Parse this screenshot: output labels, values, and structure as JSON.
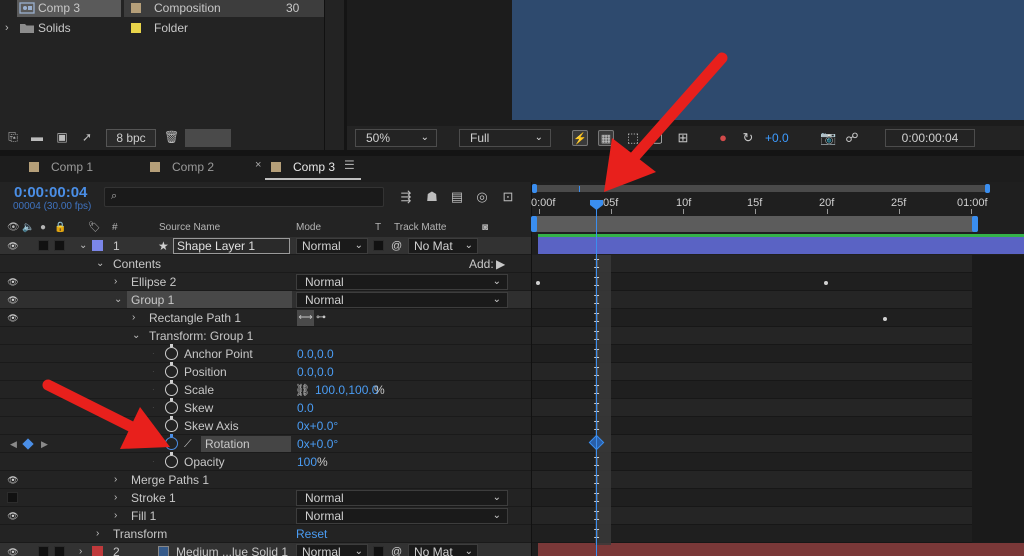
{
  "project": {
    "items": [
      {
        "name": "Comp 3",
        "type": "Composition",
        "frame_rate": "30",
        "color": "#b59f79",
        "twirl": "",
        "icon": "composition-icon"
      },
      {
        "name": "Solids",
        "type": "Folder",
        "frame_rate": "",
        "color": "#e8d44a",
        "twirl": "›",
        "icon": "folder-icon"
      }
    ],
    "footer": {
      "bit_depth": "8 bpc"
    }
  },
  "viewer": {
    "zoom": "50%",
    "resolution": "Full",
    "exposure": "+0.0",
    "timecode": "0:00:00:04"
  },
  "timeline": {
    "tabs": [
      {
        "label": "Comp 1",
        "color": "#b59f79"
      },
      {
        "label": "Comp 2",
        "color": "#b59f79"
      },
      {
        "label": "Comp 3",
        "color": "#b59f79"
      }
    ],
    "current_time": "0:00:00:04",
    "frame_info": "00004 (30.00 fps)",
    "search_icon": "⌕",
    "columns": {
      "num": "#",
      "source_name": "Source Name",
      "mode": "Mode",
      "t": "T",
      "track_matte": "Track Matte"
    },
    "ruler": [
      "0:00f",
      "05f",
      "10f",
      "15f",
      "20f",
      "25f",
      "01:00f"
    ],
    "layer1": {
      "num": "1",
      "name": "Shape Layer 1",
      "mode": "Normal",
      "matte": "No Mat",
      "color": "#7b86e8"
    },
    "layer2": {
      "num": "2",
      "name": "Medium ...lue Solid 1",
      "mode": "Normal",
      "matte": "No Mat",
      "color": "#c0393b"
    },
    "rows": {
      "contents": "Contents",
      "add_label": "Add:",
      "ellipse2": "Ellipse 2",
      "ellipse2_mode": "Normal",
      "group1": "Group 1",
      "group1_mode": "Normal",
      "rect_path": "Rectangle Path 1",
      "transform_group": "Transform: Group 1",
      "anchor_point": {
        "label": "Anchor Point",
        "value": "0.0,0.0"
      },
      "position": {
        "label": "Position",
        "value": "0.0,0.0"
      },
      "scale": {
        "label": "Scale",
        "value": "100.0,100.0",
        "unit": "%"
      },
      "skew": {
        "label": "Skew",
        "value": "0.0"
      },
      "skew_axis": {
        "label": "Skew Axis",
        "value": "0x+0.0°"
      },
      "rotation": {
        "label": "Rotation",
        "value": "0x+0.0°"
      },
      "opacity": {
        "label": "Opacity",
        "value": "100",
        "unit": "%"
      },
      "merge_paths": "Merge Paths 1",
      "stroke": "Stroke 1",
      "stroke_mode": "Normal",
      "fill": "Fill 1",
      "fill_mode": "Normal",
      "transform": "Transform",
      "transform_value": "Reset"
    }
  },
  "colors": {
    "accent": "#3a8ef0",
    "arrow": "#e8201c",
    "canvas": "#2e4a6e"
  }
}
